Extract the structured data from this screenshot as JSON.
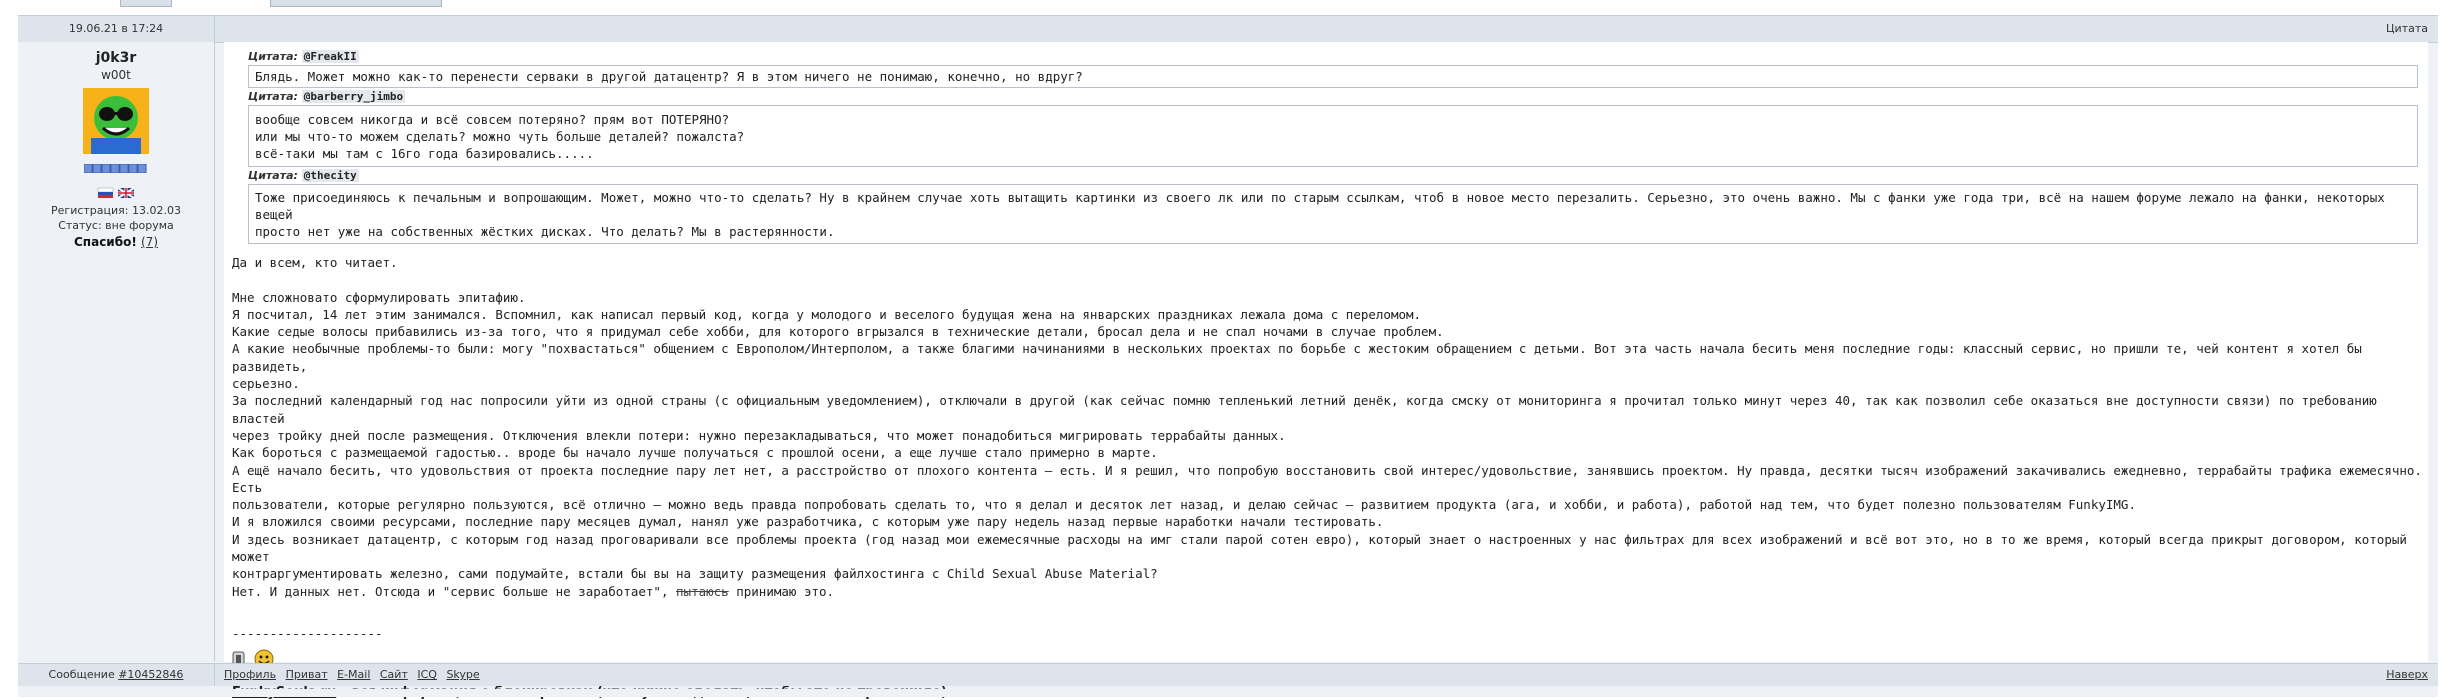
{
  "post": {
    "date": "19.06.21 в 17:24",
    "quote_link": "Цитата"
  },
  "user": {
    "nick": "j0k3r",
    "rank": "w00t",
    "registration": "Регистрация: 13.02.03",
    "status": "Статус: вне форума",
    "thanks_label": "Спасибо!",
    "thanks_count": "(7)"
  },
  "quotes": [
    {
      "label": "Цитата:",
      "author": "@FreakII",
      "lines": [
        "Блядь. Может можно как-то перенести серваки в другой датацентр? Я в этом ничего не понимаю, конечно, но вдруг?"
      ]
    },
    {
      "label": "Цитата:",
      "author": "@barberry_jimbo",
      "lines": [
        "вообще совсем никогда и всё совсем потеряно? прям вот ПОТЕРЯНО?",
        "или мы что-то можем сделать? можно чуть больше деталей? пожалста?",
        "всё-таки мы там с 16го года базировались....."
      ]
    },
    {
      "label": "Цитата:",
      "author": "@thecity",
      "lines": [
        "Тоже присоединяюсь к печальным и вопрошающим. Может, можно что-то сделать? Ну в крайнем случае хоть вытащить картинки из своего лк или по старым ссылкам, чтоб в новое место перезалить. Серьезно, это очень важно. Мы с фанки уже года три, всё на нашем форуме лежало на фанки, некоторых вещей",
        "просто нет уже на собственных жёстких дисках. Что делать? Мы в растерянности."
      ]
    }
  ],
  "message": {
    "greeting": "Да и всем, кто читает.",
    "lines": [
      "Мне сложновато сформулировать эпитафию.",
      "Я посчитал, 14 лет этим занимался. Вспомнил, как написал первый код, когда у молодого и веселого будущая жена на январских праздниках лежала дома с переломом.",
      "Какие седые волосы прибавились из-за того, что я придумал себе хобби, для которого вгрызался в технические детали, бросал дела и не спал ночами в случае проблем.",
      "А какие необычные проблемы-то были: могу \"похвастаться\" общением с Европолом/Интерполом, а также благими начинаниями в нескольких проектах по борьбе с жестоким обращением с детьми. Вот эта часть начала бесить меня последние годы: классный сервис, но пришли те, чей контент я хотел бы развидеть,",
      "серьезно.",
      "За последний календарный год нас попросили уйти из одной страны (с официальным уведомлением), отключали в другой (как сейчас помню тепленький летний денёк, когда смску от мониторинга я прочитал только минут через 40, так как позволил себе оказаться вне доступности связи) по требованию властей",
      "через тройку дней после размещения. Отключения влекли потери: нужно перезакладываться, что может понадобиться мигрировать террабайты данных.",
      "Как бороться с размещаемой гадостью.. вроде бы начало лучше получаться с прошлой осени, а еще лучше стало примерно в марте.",
      "А ещё начало бесить, что удовольствия от проекта последние пару лет нет, а расстройство от плохого контента – есть. И я решил, что попробую восстановить свой интерес/удовольствие, занявшись проектом. Ну правда, десятки тысяч изображений закачивались ежедневно, террабайты трафика ежемесячно. Есть",
      "пользователи, которые регулярно пользуются, всё отлично – можно ведь правда попробовать сделать то, что я делал и десяток лет назад, и делаю сейчас – развитием продукта (ага, и хобби, и работа), работой над тем, что будет полезно пользователям FunkyIMG.",
      "И я вложился своими ресурсами, последние пару месяцев думал, нанял уже разработчика, с которым уже пару недель назад первые наработки начали тестировать.",
      "И здесь возникает датацентр, с которым год назад проговаривали все проблемы проекта (год назад мои ежемесячные расходы на имг стали парой сотен евро), который знает о настроенных у нас фильтрах для всех изображений и всё вот это, но в то же время, который всегда прикрыт договором, который может",
      "контраргументировать железно, сами подумайте, встали бы вы на защиту размещения файлхостинга с Child Sexual Abuse Material?"
    ],
    "last_line_before": "Нет. И данных нет. Отсюда и \"сервис больше не заработает\", ",
    "last_line_struck": "пытаюсь",
    "last_line_after": " принимаю это."
  },
  "signature": {
    "separator": "--------------------",
    "site": "FunkySouls.ru",
    "tagline": " – вся информация о блокировках (что нужно сделать, чтобы это не тревожило)"
  },
  "footer": {
    "message_label": "Сообщение ",
    "message_number": "#10452846",
    "links": [
      "Профиль",
      "Приват",
      "E-Mail",
      "Сайт",
      "ICQ",
      "Skype"
    ],
    "up": "Наверх"
  },
  "colors": {
    "header_bg": "#dde4ec",
    "panel_bg": "#eef1f5",
    "border": "#c4ced9"
  }
}
